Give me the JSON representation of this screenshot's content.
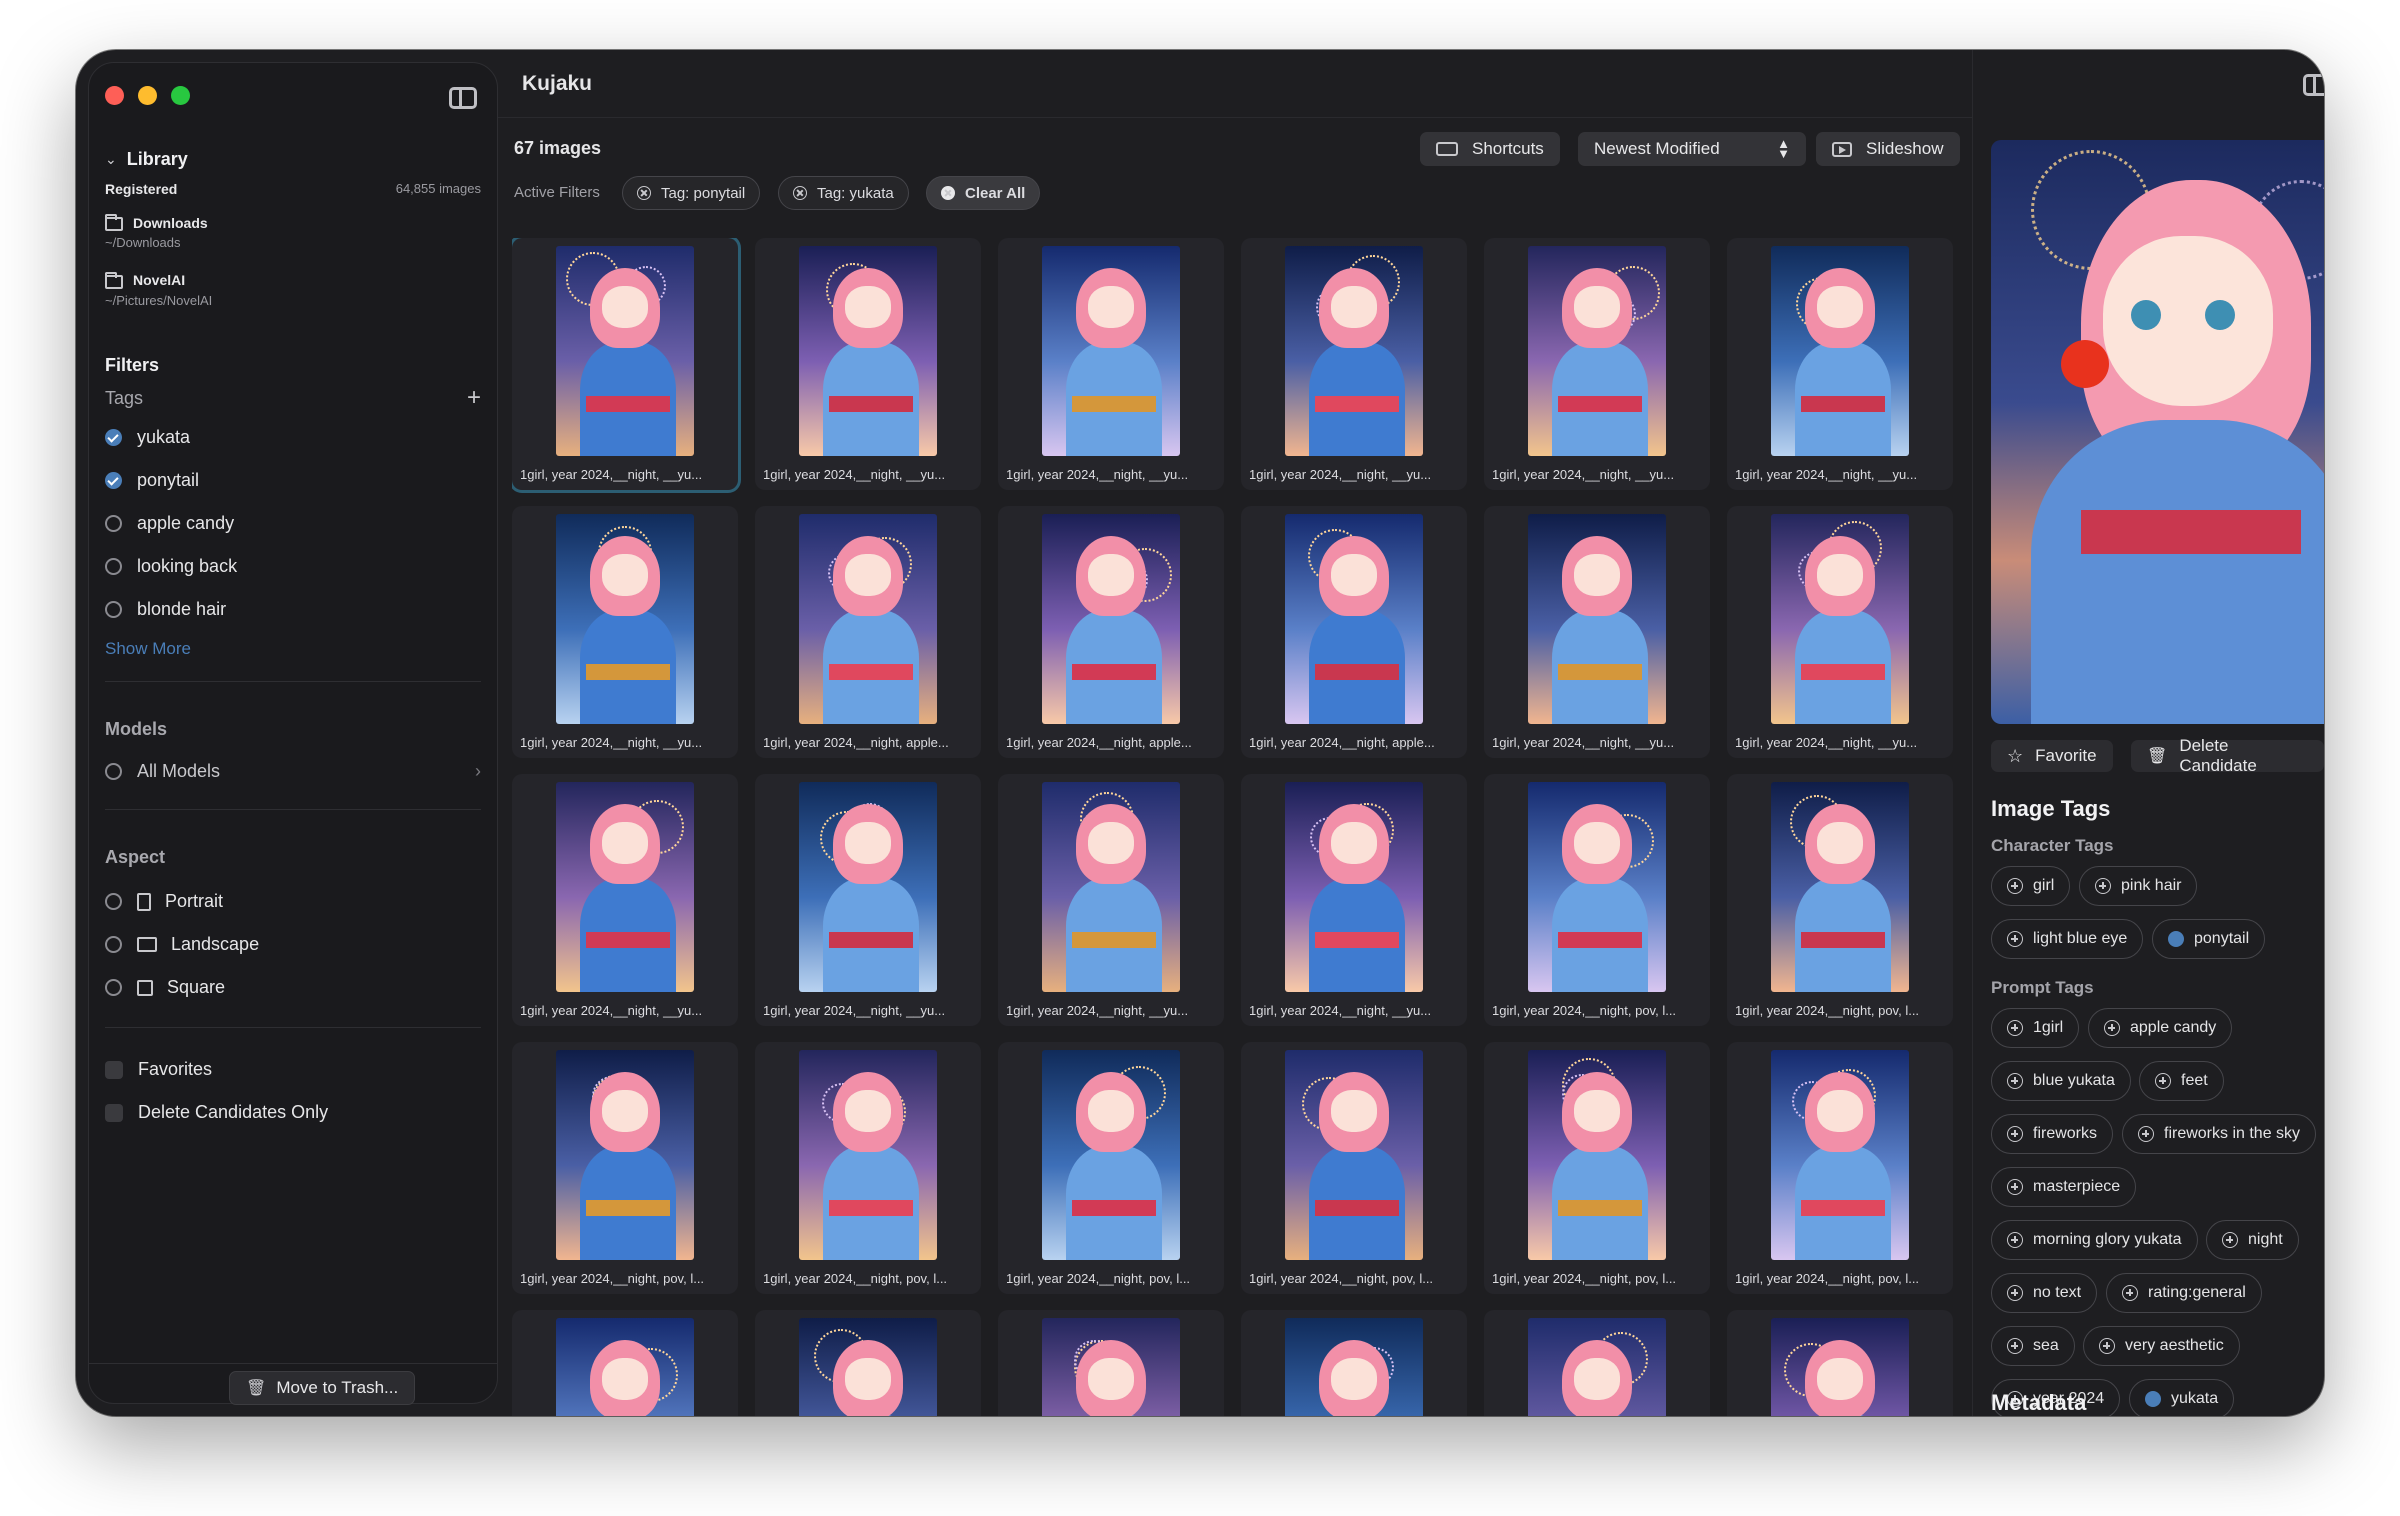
{
  "app": {
    "title": "Kujaku"
  },
  "sidebar": {
    "library_label": "Library",
    "registered_label": "Registered",
    "registered_count": "64,855 images",
    "folders": [
      {
        "name": "Downloads",
        "path": "~/Downloads"
      },
      {
        "name": "NovelAI",
        "path": "~/Pictures/NovelAI"
      }
    ],
    "filters_label": "Filters",
    "tags_label": "Tags",
    "tags": [
      {
        "label": "yukata",
        "checked": true
      },
      {
        "label": "ponytail",
        "checked": true
      },
      {
        "label": "apple candy",
        "checked": false
      },
      {
        "label": "looking back",
        "checked": false
      },
      {
        "label": "blonde hair",
        "checked": false
      }
    ],
    "show_more": "Show More",
    "models_label": "Models",
    "all_models": "All Models",
    "aspect_label": "Aspect",
    "aspects": [
      "Portrait",
      "Landscape",
      "Square"
    ],
    "favorites": "Favorites",
    "delete_candidates_only": "Delete Candidates Only",
    "move_to_trash": "Move to Trash..."
  },
  "main": {
    "count": "67 images",
    "shortcuts": "Shortcuts",
    "sort": "Newest Modified",
    "slideshow": "Slideshow",
    "active_filters_label": "Active Filters",
    "filters": [
      "Tag: ponytail",
      "Tag: yukata"
    ],
    "clear_all": "Clear All",
    "captions": [
      "1girl,  year 2024,__night, __yu...",
      "1girl,  year 2024,__night, __yu...",
      "1girl,  year 2024,__night, __yu...",
      "1girl,  year 2024,__night, __yu...",
      "1girl,  year 2024,__night, __yu...",
      "1girl,  year 2024,__night, __yu...",
      "1girl,  year 2024,__night, __yu...",
      "1girl,  year 2024,__night, apple...",
      "1girl,  year 2024,__night, apple...",
      "1girl,  year 2024,__night, apple...",
      "1girl,  year 2024,__night, __yu...",
      "1girl,  year 2024,__night, __yu...",
      "1girl,  year 2024,__night, __yu...",
      "1girl,  year 2024,__night, __yu...",
      "1girl,  year 2024,__night, __yu...",
      "1girl,  year 2024,__night, __yu...",
      "1girl,  year 2024,__night, pov, l...",
      "1girl,  year 2024,__night, pov, l...",
      "1girl,  year 2024,__night, pov, l...",
      "1girl,  year 2024,__night, pov, l...",
      "1girl,  year 2024,__night, pov, l...",
      "1girl,  year 2024,__night, pov, l...",
      "1girl,  year 2024,__night, pov, l...",
      "1girl,  year 2024,__night, pov, l...",
      "",
      "",
      "",
      "",
      "",
      ""
    ]
  },
  "detail": {
    "favorite": "Favorite",
    "delete_candidate": "Delete Candidate",
    "image_tags_title": "Image Tags",
    "character_tags_title": "Character Tags",
    "character_tags": [
      {
        "label": "girl",
        "checked": false
      },
      {
        "label": "pink hair",
        "checked": false
      },
      {
        "label": "light blue eye",
        "checked": false
      },
      {
        "label": "ponytail",
        "checked": true
      }
    ],
    "prompt_tags_title": "Prompt Tags",
    "prompt_tags": [
      {
        "label": "1girl",
        "checked": false
      },
      {
        "label": "apple candy",
        "checked": false
      },
      {
        "label": "blue yukata",
        "checked": false
      },
      {
        "label": "feet",
        "checked": false
      },
      {
        "label": "fireworks",
        "checked": false
      },
      {
        "label": "fireworks in the sky",
        "checked": false
      },
      {
        "label": "masterpiece",
        "checked": false
      },
      {
        "label": "morning glory yukata",
        "checked": false
      },
      {
        "label": "night",
        "checked": false
      },
      {
        "label": "no text",
        "checked": false
      },
      {
        "label": "rating:general",
        "checked": false
      },
      {
        "label": "sea",
        "checked": false
      },
      {
        "label": "very aesthetic",
        "checked": false
      },
      {
        "label": "year 2024",
        "checked": false
      },
      {
        "label": "yukata",
        "checked": true
      }
    ],
    "metadata_title": "Metadata"
  },
  "colors": {
    "accent": "#4a7eb8",
    "window_bg": "#1e1e21",
    "sidebar_bg": "#1a1a1d"
  }
}
